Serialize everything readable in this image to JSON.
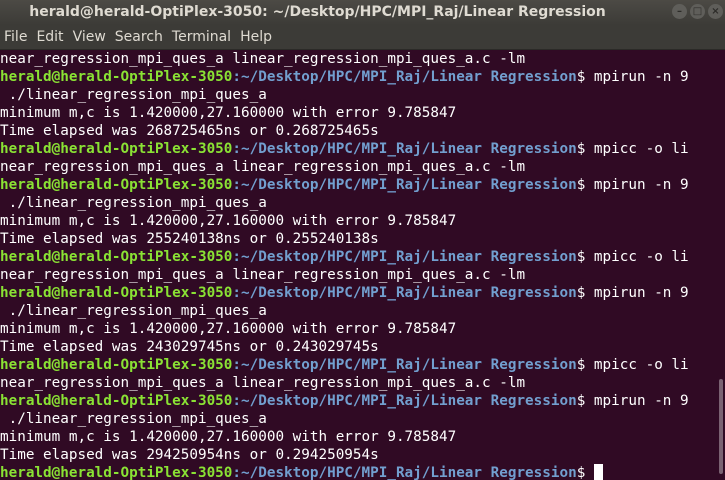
{
  "window": {
    "title": "herald@herald-OptiPlex-3050: ~/Desktop/HPC/MPI_Raj/Linear Regression",
    "buttons": {
      "minimize": "–",
      "maximize": "□",
      "close": "×"
    }
  },
  "menu": {
    "items": [
      "File",
      "Edit",
      "View",
      "Search",
      "Terminal",
      "Help"
    ]
  },
  "terminal": {
    "prompt": {
      "user_host": "herald@herald-OptiPlex-3050",
      "path": ":~/Desktop/HPC/MPI_Raj/Linear Regression",
      "dollar": "$"
    },
    "lines": [
      {
        "type": "text",
        "text": "near_regression_mpi_ques_a linear_regression_mpi_ques_a.c -lm"
      },
      {
        "type": "prompt",
        "command": " mpirun -n 9"
      },
      {
        "type": "text",
        "text": " ./linear_regression_mpi_ques_a"
      },
      {
        "type": "text",
        "text": "minimum m,c is 1.420000,27.160000 with error 9.785847"
      },
      {
        "type": "text",
        "text": "Time elapsed was 268725465ns or 0.268725465s"
      },
      {
        "type": "prompt",
        "command": " mpicc -o li"
      },
      {
        "type": "text",
        "text": "near_regression_mpi_ques_a linear_regression_mpi_ques_a.c -lm"
      },
      {
        "type": "prompt",
        "command": " mpirun -n 9"
      },
      {
        "type": "text",
        "text": " ./linear_regression_mpi_ques_a"
      },
      {
        "type": "text",
        "text": "minimum m,c is 1.420000,27.160000 with error 9.785847"
      },
      {
        "type": "text",
        "text": "Time elapsed was 255240138ns or 0.255240138s"
      },
      {
        "type": "prompt",
        "command": " mpicc -o li"
      },
      {
        "type": "text",
        "text": "near_regression_mpi_ques_a linear_regression_mpi_ques_a.c -lm"
      },
      {
        "type": "prompt",
        "command": " mpirun -n 9"
      },
      {
        "type": "text",
        "text": " ./linear_regression_mpi_ques_a"
      },
      {
        "type": "text",
        "text": "minimum m,c is 1.420000,27.160000 with error 9.785847"
      },
      {
        "type": "text",
        "text": "Time elapsed was 243029745ns or 0.243029745s"
      },
      {
        "type": "prompt",
        "command": " mpicc -o li"
      },
      {
        "type": "text",
        "text": "near_regression_mpi_ques_a linear_regression_mpi_ques_a.c -lm"
      },
      {
        "type": "prompt",
        "command": " mpirun -n 9"
      },
      {
        "type": "text",
        "text": " ./linear_regression_mpi_ques_a"
      },
      {
        "type": "text",
        "text": "minimum m,c is 1.420000,27.160000 with error 9.785847"
      },
      {
        "type": "text",
        "text": "Time elapsed was 294250954ns or 0.294250954s"
      },
      {
        "type": "prompt",
        "command": " ",
        "cursor": true
      }
    ]
  },
  "colors": {
    "background": "#300a24",
    "prompt_user": "#8ae234",
    "prompt_path": "#729fcf",
    "text": "#ffffff"
  }
}
